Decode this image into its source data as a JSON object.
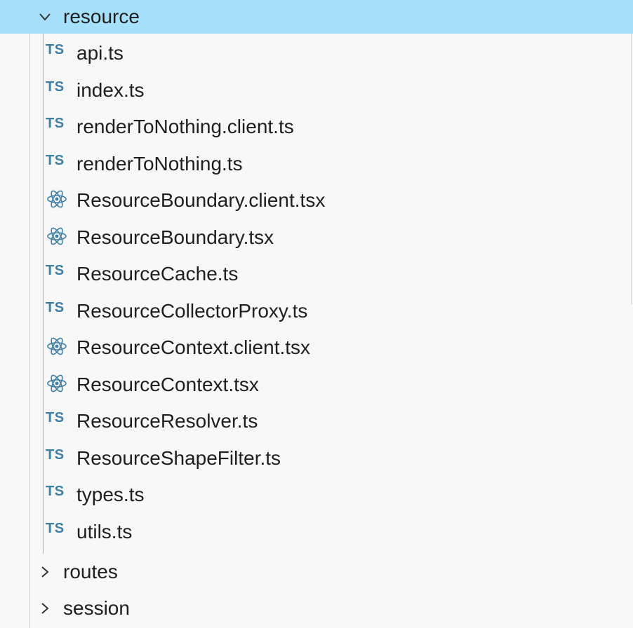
{
  "explorer": {
    "folder_open": {
      "name": "resource",
      "expanded": true,
      "icon": "chevron-down-icon"
    },
    "files": [
      {
        "name": "api.ts",
        "icon": "typescript-file-icon",
        "icon_text": "TS"
      },
      {
        "name": "index.ts",
        "icon": "typescript-file-icon",
        "icon_text": "TS"
      },
      {
        "name": "renderToNothing.client.ts",
        "icon": "typescript-file-icon",
        "icon_text": "TS"
      },
      {
        "name": "renderToNothing.ts",
        "icon": "typescript-file-icon",
        "icon_text": "TS"
      },
      {
        "name": "ResourceBoundary.client.tsx",
        "icon": "react-file-icon"
      },
      {
        "name": "ResourceBoundary.tsx",
        "icon": "react-file-icon"
      },
      {
        "name": "ResourceCache.ts",
        "icon": "typescript-file-icon",
        "icon_text": "TS"
      },
      {
        "name": "ResourceCollectorProxy.ts",
        "icon": "typescript-file-icon",
        "icon_text": "TS"
      },
      {
        "name": "ResourceContext.client.tsx",
        "icon": "react-file-icon"
      },
      {
        "name": "ResourceContext.tsx",
        "icon": "react-file-icon"
      },
      {
        "name": "ResourceResolver.ts",
        "icon": "typescript-file-icon",
        "icon_text": "TS"
      },
      {
        "name": "ResourceShapeFilter.ts",
        "icon": "typescript-file-icon",
        "icon_text": "TS"
      },
      {
        "name": "types.ts",
        "icon": "typescript-file-icon",
        "icon_text": "TS"
      },
      {
        "name": "utils.ts",
        "icon": "typescript-file-icon",
        "icon_text": "TS"
      }
    ],
    "folders_collapsed": [
      {
        "name": "routes",
        "expanded": false,
        "icon": "chevron-right-icon"
      },
      {
        "name": "session",
        "expanded": false,
        "icon": "chevron-right-icon"
      }
    ]
  },
  "colors": {
    "selection": "#a7e0fb",
    "background": "#f8f8f8",
    "text": "#1f1f1f",
    "ts_icon": "#3e7fa8",
    "react_icon": "#3e7fa8"
  }
}
